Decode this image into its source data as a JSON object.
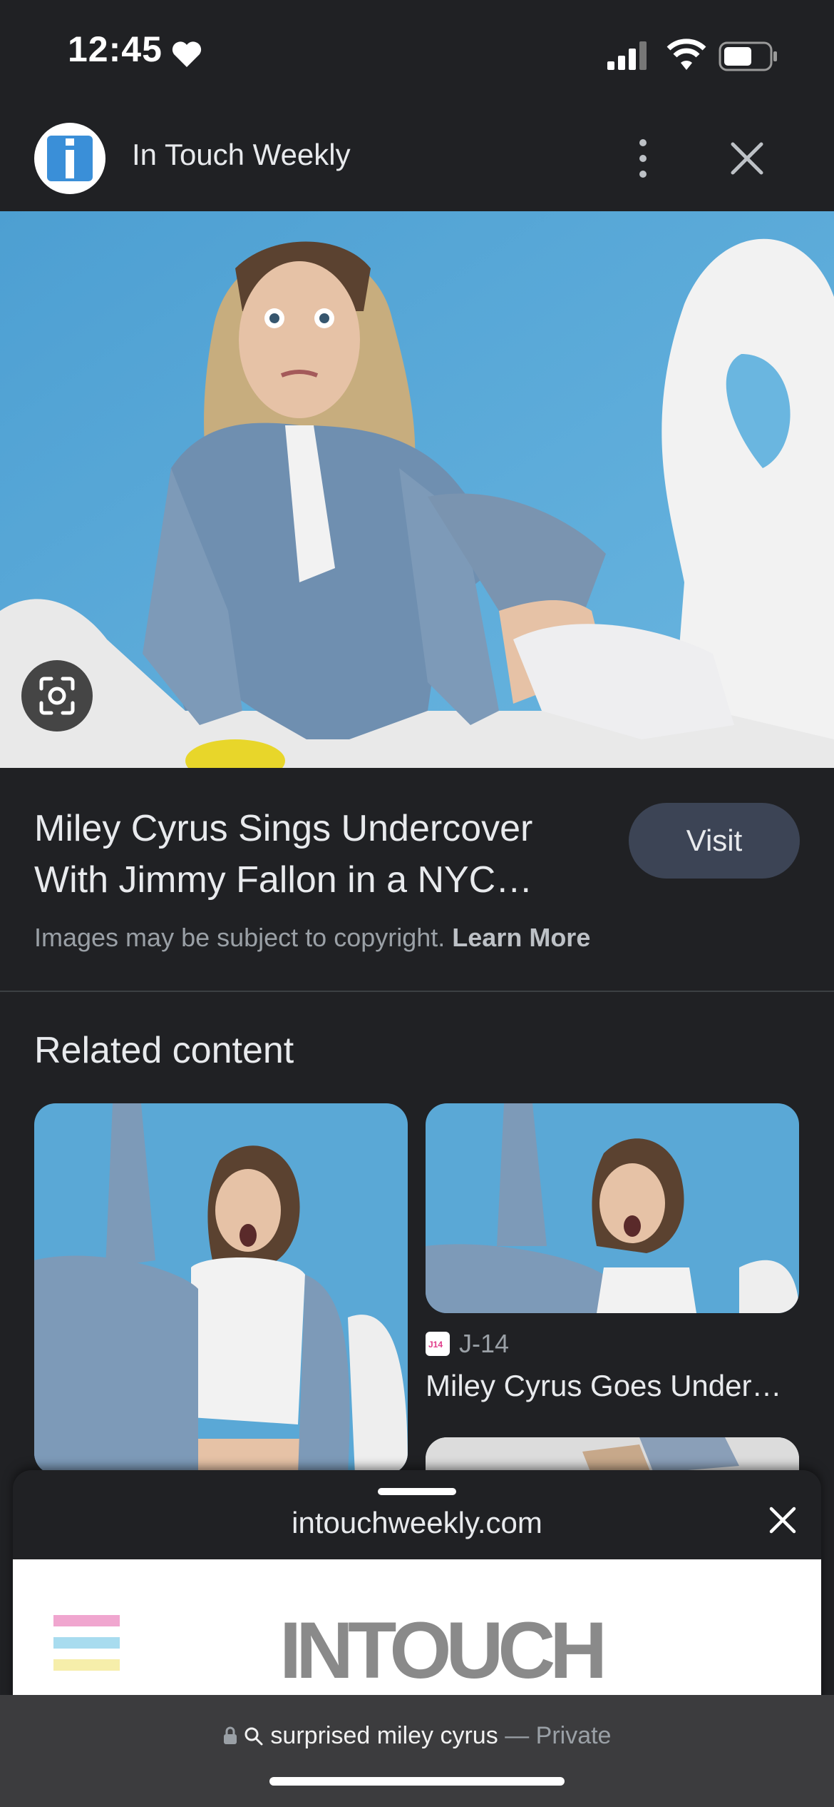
{
  "status_bar": {
    "time": "12:45"
  },
  "header": {
    "site_name": "In Touch Weekly"
  },
  "result": {
    "title": "Miley Cyrus Sings Undercover With Jimmy Fallon in a NYC…",
    "visit_label": "Visit",
    "copyright_text": "Images may be subject to copyright.",
    "learn_more": "Learn More"
  },
  "related": {
    "heading": "Related content",
    "items": [
      {
        "source": "J-14",
        "title": "Miley Cyrus Goes Under…"
      }
    ]
  },
  "sheet": {
    "domain": "intouchweekly.com",
    "logo_text": "InTouch"
  },
  "urlbar": {
    "query": "surprised miley cyrus",
    "separator": "—",
    "mode": "Private"
  },
  "colors": {
    "background": "#202124",
    "visit_button": "#3c4455",
    "sky_blue": "#5aa8d6"
  }
}
